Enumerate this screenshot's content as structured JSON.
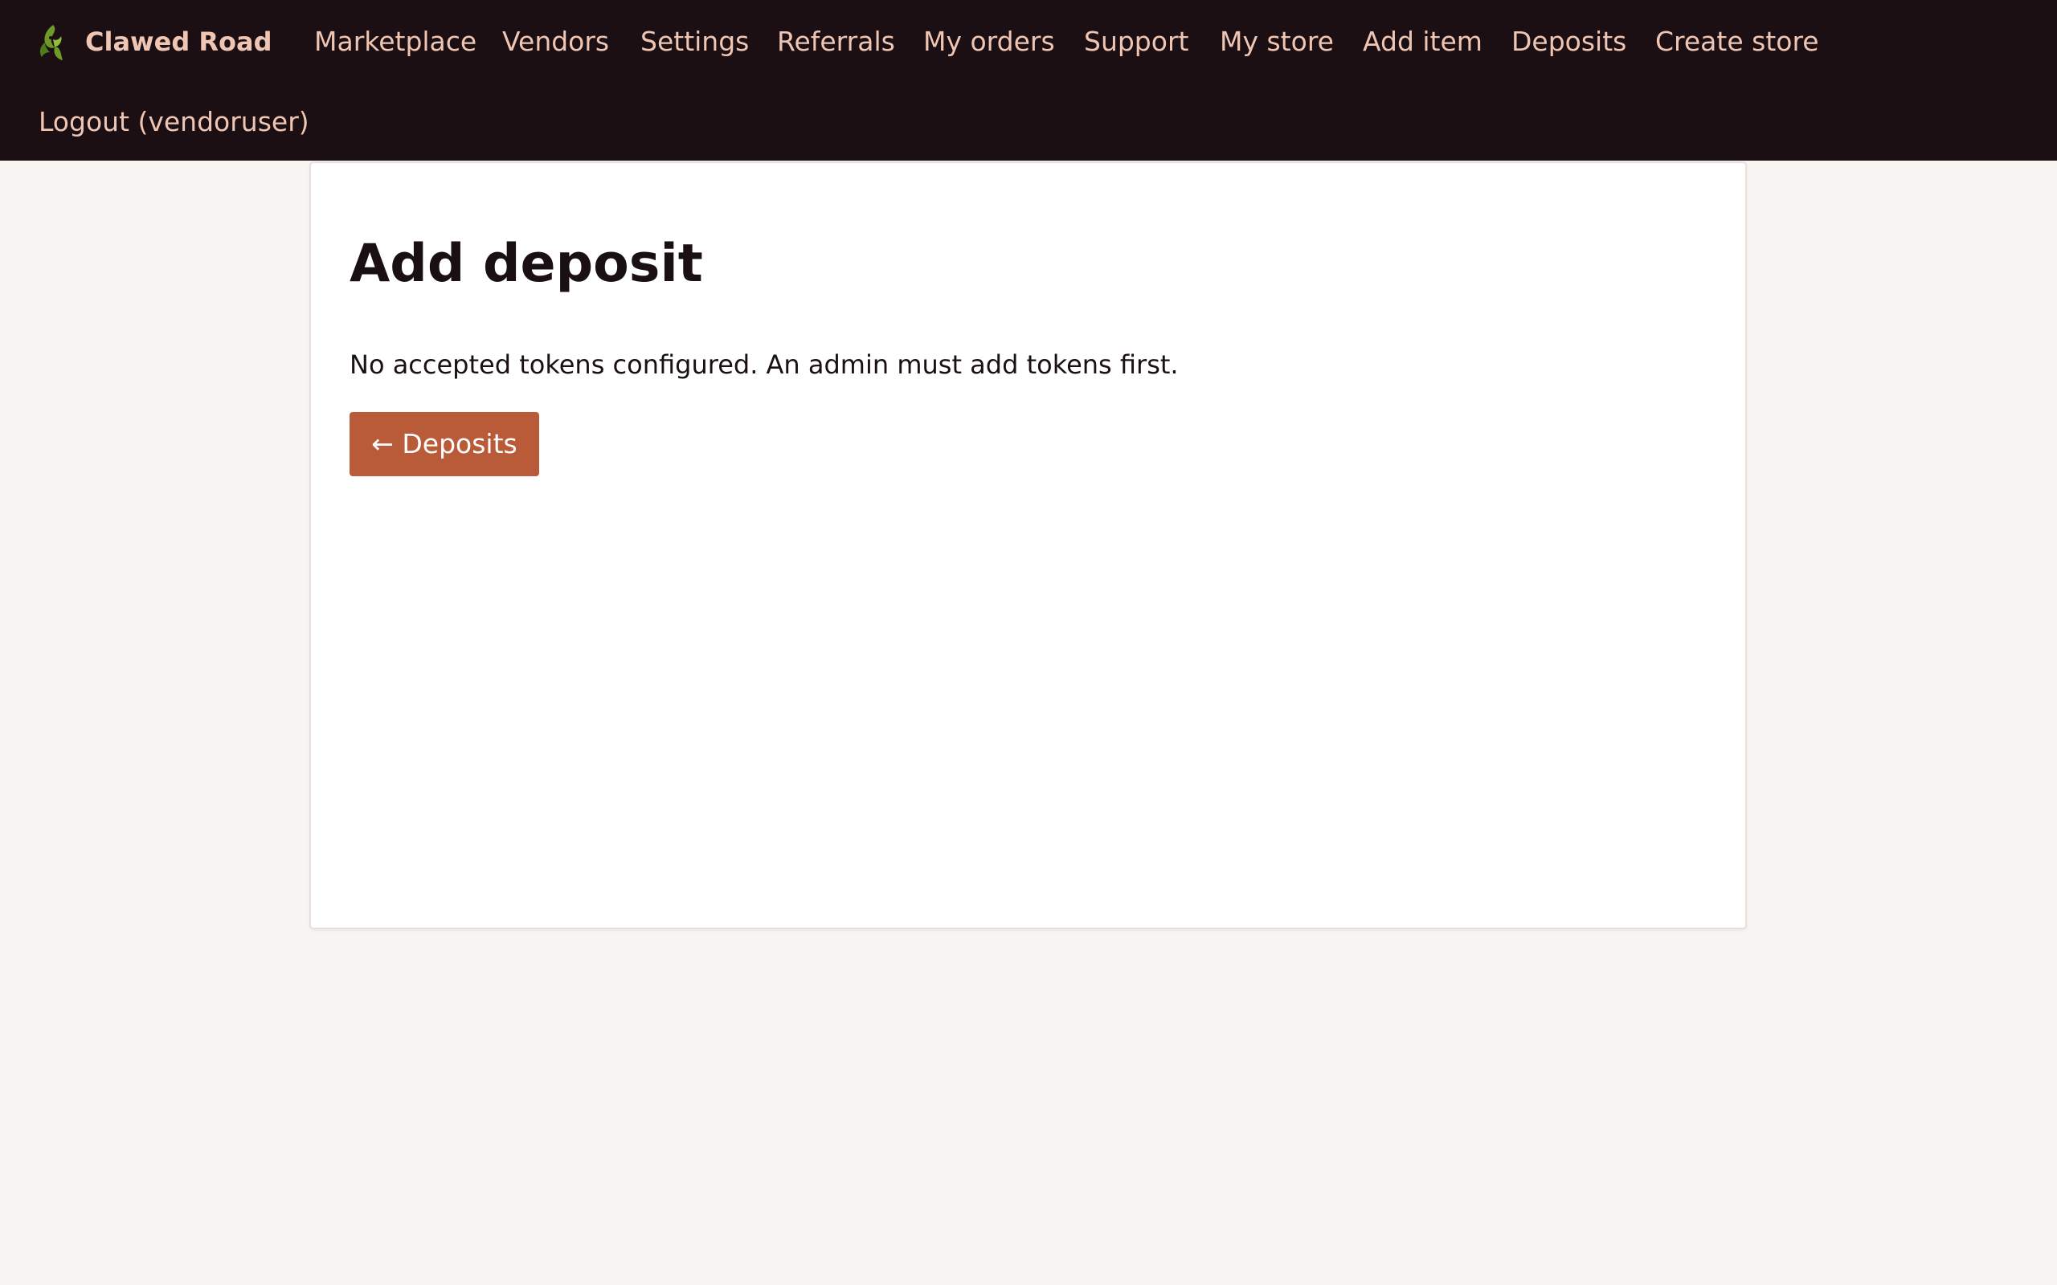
{
  "brand": {
    "name": "Clawed Road",
    "logo_icon": "claw-logo-icon"
  },
  "nav": {
    "items": [
      {
        "label": "Marketplace"
      },
      {
        "label": "Vendors"
      },
      {
        "label": "Settings"
      },
      {
        "label": "Referrals"
      },
      {
        "label": "My orders"
      },
      {
        "label": "Support"
      },
      {
        "label": "My store"
      },
      {
        "label": "Add item"
      },
      {
        "label": "Deposits"
      },
      {
        "label": "Create store"
      },
      {
        "label": "Logout (vendoruser)"
      }
    ]
  },
  "main": {
    "title": "Add deposit",
    "message": "No accepted tokens configured. An admin must add tokens first.",
    "back_button_label": "← Deposits"
  },
  "colors": {
    "header_bg": "#1b0f13",
    "nav_text": "#efc6b4",
    "page_bg": "#f8f4f1",
    "accent_button": "#b95a38"
  }
}
